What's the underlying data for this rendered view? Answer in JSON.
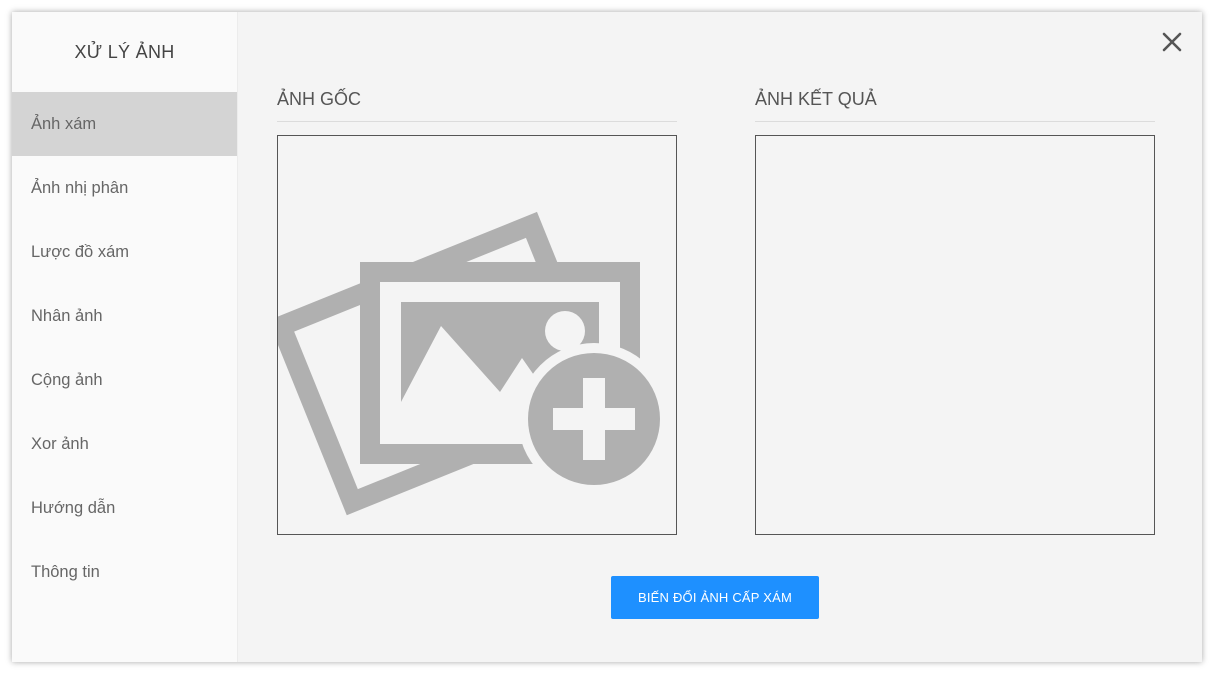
{
  "sidebar": {
    "title": "XỬ LÝ ẢNH",
    "items": [
      {
        "label": "Ảnh xám",
        "active": true
      },
      {
        "label": "Ảnh nhị phân",
        "active": false
      },
      {
        "label": "Lược đồ xám",
        "active": false
      },
      {
        "label": "Nhân ảnh",
        "active": false
      },
      {
        "label": "Cộng ảnh",
        "active": false
      },
      {
        "label": "Xor ảnh",
        "active": false
      },
      {
        "label": "Hướng dẫn",
        "active": false
      },
      {
        "label": "Thông tin",
        "active": false
      }
    ]
  },
  "main": {
    "source_panel": {
      "title": "ẢNH GỐC",
      "icon": "add-image-icon"
    },
    "result_panel": {
      "title": "ẢNH KẾT QUẢ"
    },
    "convert_button": {
      "label": "BIẾN ĐỔI ẢNH CẤP XÁM"
    },
    "close_icon": "close-icon"
  },
  "colors": {
    "window_bg": "#f4f4f4",
    "sidebar_bg": "#fafafa",
    "active_item_bg": "#d4d4d4",
    "accent": "#1e90ff",
    "icon_gray": "#b0b0b0"
  }
}
